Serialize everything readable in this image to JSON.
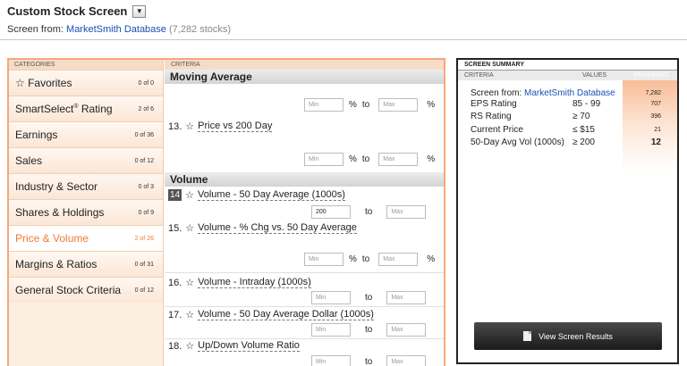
{
  "header": {
    "title": "Custom Stock Screen",
    "subtitle_prefix": "Screen from:",
    "database_link": "MarketSmith Database",
    "stock_count": "(7,282 stocks)"
  },
  "categories": {
    "header": "CATEGORIES",
    "items": [
      {
        "label": "☆ Favorites",
        "count": "0 of 0"
      },
      {
        "label": "SmartSelect",
        "sup": "®",
        "label_suffix": " Rating",
        "count": "2 of 6"
      },
      {
        "label": "Earnings",
        "count": "0 of 36"
      },
      {
        "label": "Sales",
        "count": "0 of 12"
      },
      {
        "label": "Industry & Sector",
        "count": "0 of 3"
      },
      {
        "label": "Shares & Holdings",
        "count": "0 of 9"
      },
      {
        "label": "Price & Volume",
        "count": "2 of 26",
        "active": true
      },
      {
        "label": "Margins & Ratios",
        "count": "0 of 31"
      },
      {
        "label": "General Stock Criteria",
        "count": "0 of 12"
      }
    ]
  },
  "criteria": {
    "header": "CRITERIA",
    "section_ma": "Moving Average",
    "section_volume": "Volume",
    "min_placeholder": "Min",
    "max_placeholder": "Max",
    "to_label": "to",
    "pct_label": "%",
    "star": "☆",
    "items": [
      {
        "num": "13.",
        "name": "Price vs 200 Day"
      },
      {
        "num": "14",
        "name": "Volume - 50 Day Average (1000s)",
        "min_value": "200"
      },
      {
        "num": "15.",
        "name": "Volume - % Chg vs. 50 Day Average"
      },
      {
        "num": "16.",
        "name": "Volume - Intraday (1000s)"
      },
      {
        "num": "17.",
        "name": "Volume - 50 Day Average Dollar (1000s)"
      },
      {
        "num": "18.",
        "name": "Up/Down Volume Ratio"
      }
    ]
  },
  "summary": {
    "title": "SCREEN SUMMARY",
    "col_criteria": "CRITERIA",
    "col_values": "VALUES",
    "col_remaining": "REMAINING",
    "screen_from_label": "Screen from:",
    "screen_from_link": "MarketSmith Database",
    "screen_from_remaining": "7,282",
    "rows": [
      {
        "criteria": "EPS Rating",
        "value": "85 - 99",
        "remaining": "707"
      },
      {
        "criteria": "RS Rating",
        "value": "≥ 70",
        "remaining": "396"
      },
      {
        "criteria": "Current Price",
        "value": "≤ $15",
        "remaining": "21"
      },
      {
        "criteria": "50-Day Avg Vol (1000s)",
        "value": "≥ 200",
        "remaining": "12",
        "bold": true
      }
    ],
    "button_label": "View Screen Results"
  },
  "colors": {
    "accent": "#f07a36",
    "link": "#1a4fb3",
    "frame": "#f6a77a"
  }
}
